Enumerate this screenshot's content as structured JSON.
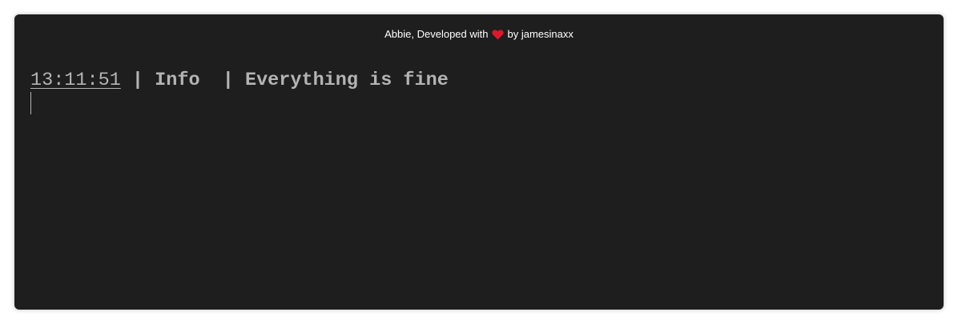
{
  "footer": {
    "prefix": "Abbie, Developed with",
    "heart_icon": "heart-icon",
    "heart_color": "#e0162b",
    "suffix": "by jamesinaxx"
  },
  "log": {
    "entries": [
      {
        "time": "13:11:51",
        "separator1": " | ",
        "level": "Info ",
        "separator2": " | ",
        "message": "Everything is fine"
      }
    ]
  },
  "colors": {
    "background": "#1e1e1e",
    "text": "#b4b4b4",
    "credit_text": "#ffffff"
  }
}
